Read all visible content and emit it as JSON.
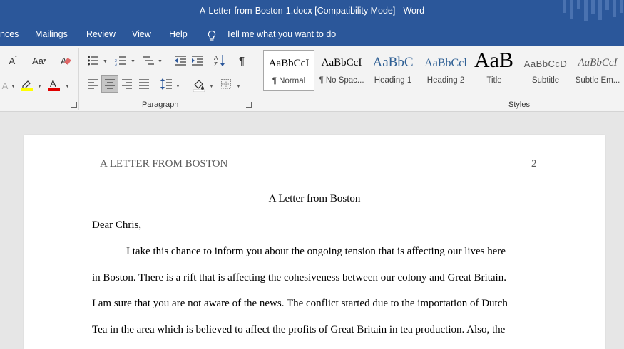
{
  "window": {
    "title": "A-Letter-from-Boston-1.docx [Compatibility Mode]  -  Word"
  },
  "menu": {
    "tabs": [
      "nces",
      "Mailings",
      "Review",
      "View",
      "Help"
    ],
    "tell_me": "Tell me what you want to do"
  },
  "ribbon": {
    "font_size_label": "Aa",
    "paragraph_label": "Paragraph",
    "styles_label": "Styles",
    "styles": [
      {
        "sample": "AaBbCcI",
        "name": "¶ Normal"
      },
      {
        "sample": "AaBbCcI",
        "name": "¶ No Spac..."
      },
      {
        "sample": "AaBbC",
        "name": "Heading 1"
      },
      {
        "sample": "AaBbCcl",
        "name": "Heading 2"
      },
      {
        "sample": "AaB",
        "name": "Title"
      },
      {
        "sample": "AaBbCcD",
        "name": "Subtitle"
      },
      {
        "sample": "AaBbCcI",
        "name": "Subtle Em..."
      }
    ],
    "colors": {
      "highlight": "#ffff00",
      "font_color": "#e00000",
      "accent": "#2b579a"
    }
  },
  "document": {
    "header": "A LETTER FROM BOSTON",
    "page_number": "2",
    "title": "A Letter from Boston",
    "salutation": "Dear Chris,",
    "lines": [
      "I take this chance to inform you about the ongoing tension that is affecting our lives here",
      "in Boston. There is a rift that is affecting the cohesiveness between our colony and Great Britain.",
      "I am sure that you are not aware of the news. The conflict started due to the importation of Dutch",
      "Tea in the area which is believed to affect the profits of Great Britain in tea production. Also, the"
    ]
  }
}
